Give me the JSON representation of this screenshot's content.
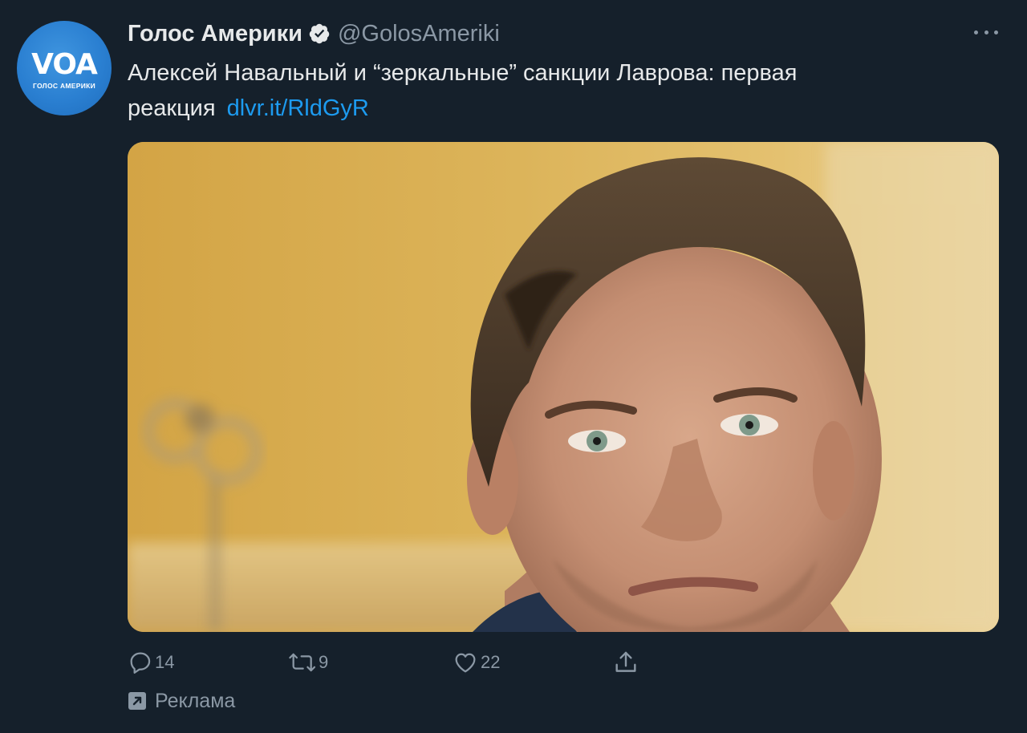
{
  "tweet": {
    "author": {
      "name": "Голос Америки",
      "handle": "@GolosAmeriki",
      "avatar_logo": "VOA",
      "avatar_subtitle": "ГОЛОС АМЕРИКИ",
      "verified": true,
      "verified_icon": "verified-badge-icon"
    },
    "text": "Алексей Навальный и “зеркальные” санкции Лаврова: первая реакция",
    "link": "dlvr.it/RldGyR",
    "media": {
      "icon": "photo-image"
    },
    "actions": {
      "reply": {
        "icon": "reply-icon",
        "count": "14"
      },
      "retweet": {
        "icon": "retweet-icon",
        "count": "9"
      },
      "like": {
        "icon": "heart-icon",
        "count": "22"
      },
      "share": {
        "icon": "share-icon"
      }
    },
    "more_icon": "more-icon",
    "promoted": {
      "icon": "promoted-arrow-icon",
      "label": "Реклама"
    }
  },
  "colors": {
    "background": "#15202b",
    "text_primary": "#e7e9ea",
    "text_secondary": "#8b98a5",
    "link": "#1d9bf0",
    "avatar_blue": "#2a7fd1"
  }
}
